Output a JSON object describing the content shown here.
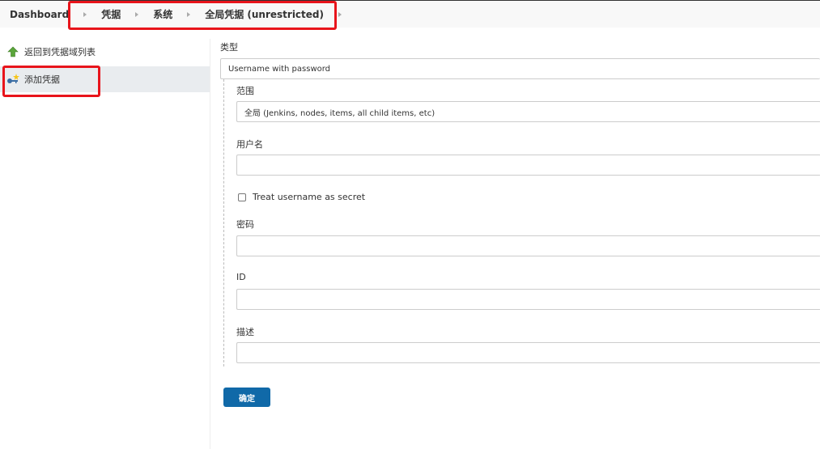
{
  "breadcrumb": {
    "items": [
      "Dashboard",
      "凭据",
      "系统",
      "全局凭据 (unrestricted)"
    ]
  },
  "sidebar": {
    "items": [
      {
        "label": "返回到凭据域列表",
        "icon": "up-arrow-icon"
      },
      {
        "label": "添加凭据",
        "icon": "add-credential-icon"
      }
    ]
  },
  "form": {
    "kind_label": "类型",
    "kind_value": "Username with password",
    "scope_label": "范围",
    "scope_value": "全局 (Jenkins, nodes, items, all child items, etc)",
    "username_label": "用户名",
    "username_value": "",
    "secret_checkbox_label": "Treat username as secret",
    "password_label": "密码",
    "password_value": "",
    "id_label": "ID",
    "id_value": "",
    "description_label": "描述",
    "description_value": "",
    "ok_button": "确定"
  },
  "colors": {
    "highlight": "#e8141b",
    "button": "#1069a8",
    "up_arrow": "#5aa53a"
  }
}
